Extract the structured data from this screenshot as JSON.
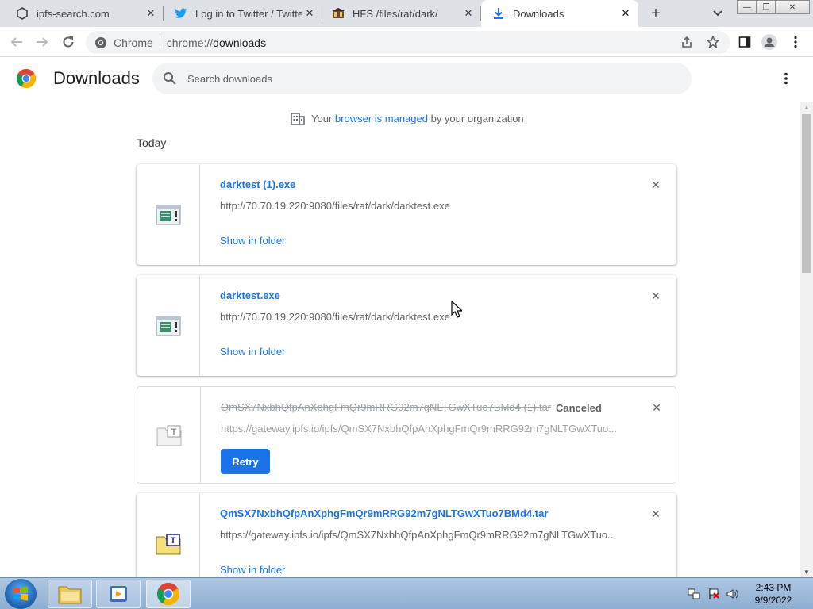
{
  "tabs": [
    {
      "title": "ipfs-search.com",
      "icon": "ipfs-icon",
      "active": false
    },
    {
      "title": "Log in to Twitter / Twitter",
      "icon": "twitter-icon",
      "active": false
    },
    {
      "title": "HFS /files/rat/dark/",
      "icon": "hfs-icon",
      "active": false
    },
    {
      "title": "Downloads",
      "icon": "download-icon",
      "active": true
    }
  ],
  "toolbar": {
    "site_label": "Chrome",
    "url_scheme": "chrome://",
    "url_path": "downloads"
  },
  "header": {
    "title": "Downloads",
    "search_placeholder": "Search downloads"
  },
  "managed": {
    "prefix": "Your",
    "link": "browser is managed",
    "suffix": "by your organization"
  },
  "section_label": "Today",
  "downloads": [
    {
      "file_name": "darktest (1).exe",
      "url": "http://70.70.19.220:9080/files/rat/dark/darktest.exe",
      "action": "Show in folder",
      "status": ""
    },
    {
      "file_name": "darktest.exe",
      "url": "http://70.70.19.220:9080/files/rat/dark/darktest.exe",
      "action": "Show in folder",
      "status": ""
    },
    {
      "file_name": "QmSX7NxbhQfpAnXphgFmQr9mRRG92m7gNLTGwXTuo7BMd4 (1).tar",
      "url": "https://gateway.ipfs.io/ipfs/QmSX7NxbhQfpAnXphgFmQr9mRRG92m7gNLTGwXTuo...",
      "action": "Retry",
      "status": "Canceled"
    },
    {
      "file_name": "QmSX7NxbhQfpAnXphgFmQr9mRRG92m7gNLTGwXTuo7BMd4.tar",
      "url": "https://gateway.ipfs.io/ipfs/QmSX7NxbhQfpAnXphgFmQr9mRRG92m7gNLTGwXTuo...",
      "action": "Show in folder",
      "status": ""
    }
  ],
  "taskbar": {
    "time": "2:43 PM",
    "date": "9/9/2022"
  },
  "colors": {
    "accent": "#1a73e8",
    "tabstrip": "#dee1e6"
  }
}
